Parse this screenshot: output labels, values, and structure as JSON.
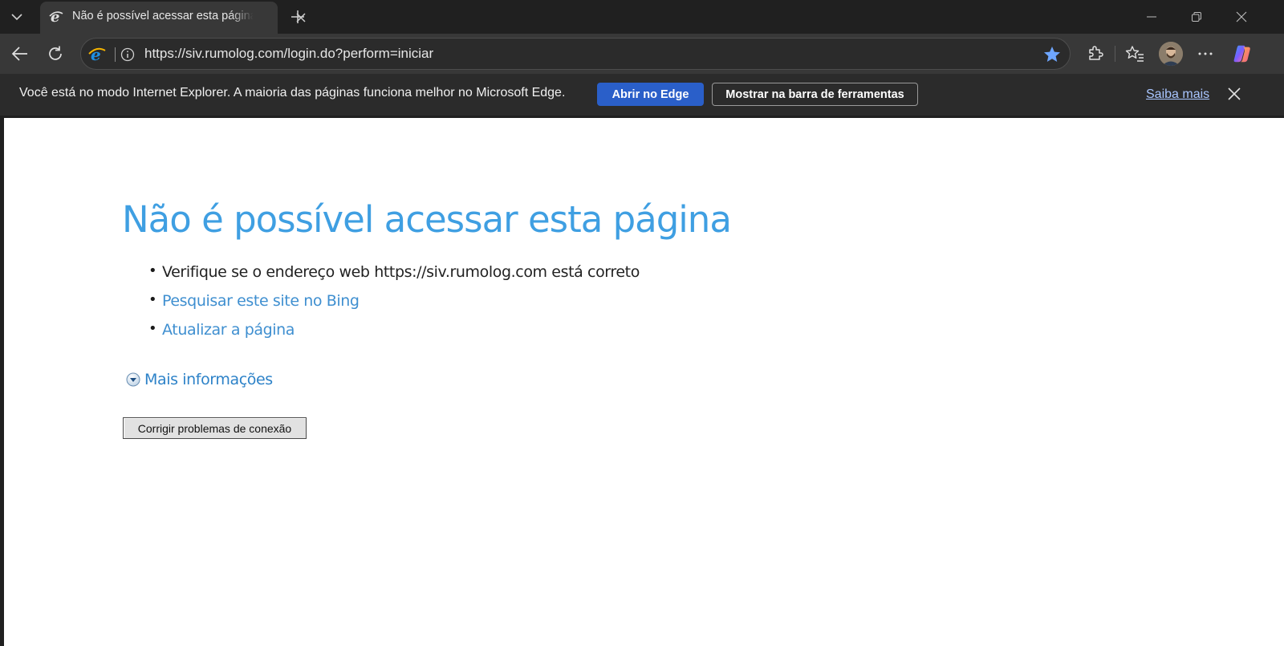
{
  "tab": {
    "title": "Não é possível acessar esta página",
    "favicon": "ie-icon"
  },
  "toolbar": {
    "url": "https://siv.rumolog.com/login.do?perform=iniciar"
  },
  "infobar": {
    "message": "Você está no modo Internet Explorer. A maioria das páginas funciona melhor no Microsoft Edge.",
    "open_edge_label": "Abrir no Edge",
    "show_toolbar_label": "Mostrar na barra de ferramentas",
    "learn_more_label": "Saiba mais"
  },
  "error_page": {
    "title": "Não é possível acessar esta página",
    "items": [
      {
        "text": "Verifique se o endereço web https://siv.rumolog.com está correto",
        "link": false
      },
      {
        "text": "Pesquisar este site no Bing",
        "link": true
      },
      {
        "text": "Atualizar a página",
        "link": true
      }
    ],
    "more_info_label": "Mais informações",
    "fix_button_label": "Corrigir problemas de conexão"
  },
  "colors": {
    "accent_blue": "#2a5fc9",
    "error_title_blue": "#3f9fe2",
    "link_blue": "#3f8fd0"
  }
}
